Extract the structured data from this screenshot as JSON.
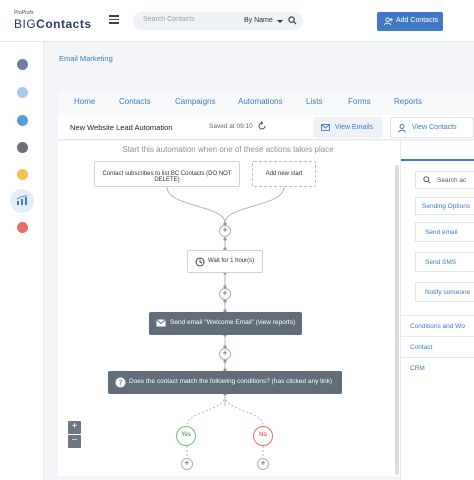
{
  "brand": {
    "small": "ProProfs",
    "name_light": "BIG",
    "name_bold": "Contacts"
  },
  "search": {
    "placeholder": "Search Contacts",
    "by_label": "By Name"
  },
  "header": {
    "add_contacts_label": "Add Contacts"
  },
  "sidebar": {
    "dot_colors": [
      "#6b7f9e",
      "#a9cbed",
      "#5b9ae0",
      "#6a6f75",
      "#f2c14e",
      "#e86a6a"
    ]
  },
  "breadcrumb": "Email Marketing",
  "nav": {
    "tabs": [
      "Home",
      "Contacts",
      "Campaigns",
      "Automations",
      "Lists",
      "Forms",
      "Reports"
    ]
  },
  "automation": {
    "title": "New Website Lead Automation",
    "saved_text": "Saved at 09:10",
    "view_emails_label": "View Emails",
    "view_contacts_label": "View Contacts"
  },
  "workflow": {
    "start_text": "Start this automation when one of these actions takes place",
    "trigger_label": "Contact subscribes to list BC Contacts (DO NOT DELETE)",
    "add_new_start_label": "Add new start",
    "wait_label": "Wait for 1 hour(s)",
    "send_email_label": "Send email \"Welcome Email\" (view reports)",
    "condition_label": "Does the contact match the following conditions? (has clicked any link)",
    "yes_label": "Yes",
    "no_label": "No",
    "plus": "+",
    "zoom_in": "+",
    "zoom_out": "−"
  },
  "right_panel": {
    "search_label": "Search ac",
    "sending_options": "Sending Options",
    "items": [
      "Send email",
      "Send SMS",
      "Notify someone"
    ],
    "sections": [
      "Conditions and Wo",
      "Contact",
      "CRM"
    ]
  },
  "colors": {
    "accent": "#3f79c5",
    "dark_node": "#626d7a",
    "yes": "#6fbf73",
    "no": "#e57373"
  }
}
